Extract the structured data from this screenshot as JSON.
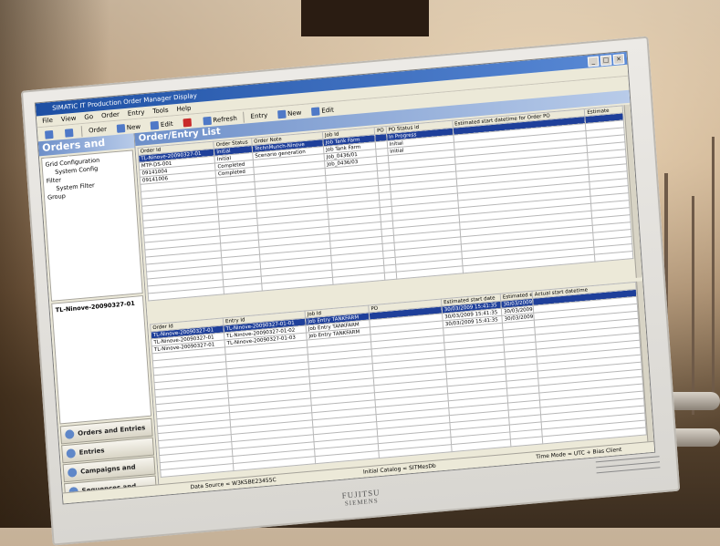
{
  "app": {
    "title": "SIMATIC IT Production Order Manager Display",
    "window_controls": [
      "_",
      "□",
      "×"
    ]
  },
  "menu": [
    "File",
    "View",
    "Go",
    "Order",
    "Entry",
    "Tools",
    "Help"
  ],
  "toolbar": {
    "order_label": "Order",
    "items": [
      "New",
      "Edit",
      "Refresh"
    ],
    "entry_label": "Entry",
    "entry_items": [
      "New",
      "Edit"
    ]
  },
  "left_panel": {
    "header": "Orders and Entries",
    "tree": [
      "Grid Configuration",
      "System Config",
      "Filter",
      "System Filter",
      "Group"
    ],
    "lower_tree": [
      "TL-Ninove-20090327-01"
    ],
    "nav_buttons": [
      "Orders and Entries",
      "Entries",
      "Campaigns and Orders",
      "Sequences and Entries"
    ]
  },
  "order_list": {
    "header": "Order/Entry List",
    "columns": [
      "Order Id",
      "Order Status",
      "Order Note",
      "Job Id",
      "PO",
      "PO Status id",
      "Estimated start datetime for Order PO",
      "Estimate"
    ],
    "rows": [
      [
        "TL-Ninove-20090327-01",
        "Initial",
        "TechnMunch-Ninove",
        "Job Tank Farm",
        "",
        "In Progress",
        "",
        ""
      ],
      [
        "MTP-DS-001",
        "Initial",
        "Scenario generation",
        "Job Tank Farm",
        "",
        "Initial",
        "",
        ""
      ],
      [
        "09141004",
        "Completed",
        "",
        "Job_0436/01",
        "",
        "Initial",
        "",
        ""
      ],
      [
        "09141006",
        "Completed",
        "",
        "Job_0436/03",
        "",
        "",
        "",
        ""
      ]
    ]
  },
  "entry_list": {
    "columns": [
      "Order Id",
      "Entry Id",
      "Job Id",
      "PO",
      "Estimated start date",
      "Estimated end",
      "Actual start datetime"
    ],
    "rows": [
      [
        "TL-Ninove-20090327-01",
        "TL-Ninove-20090327-01-01",
        "Job Entry TANKFARM",
        "",
        "30/03/2009 15:41:35",
        "30/03/2009",
        ""
      ],
      [
        "TL-Ninove-20090327-01",
        "TL-Ninove-20090327-01-02",
        "Job Entry TANKFARM",
        "",
        "30/03/2009 15:41:35",
        "30/03/2009",
        ""
      ],
      [
        "TL-Ninove-20090327-01",
        "TL-Ninove-20090327-01-03",
        "Job Entry TANKFARM",
        "",
        "30/03/2009 15:41:35",
        "30/03/2009",
        ""
      ]
    ]
  },
  "status_bar": {
    "data_source": "Data Source = W3K5BE23455C",
    "catalog": "Initial Catalog = SITMesDb",
    "time_mode": "Time Mode = UTC + Bias Client"
  },
  "monitor": {
    "brand": "FUJITSU",
    "brand_sub": "SIEMENS"
  }
}
